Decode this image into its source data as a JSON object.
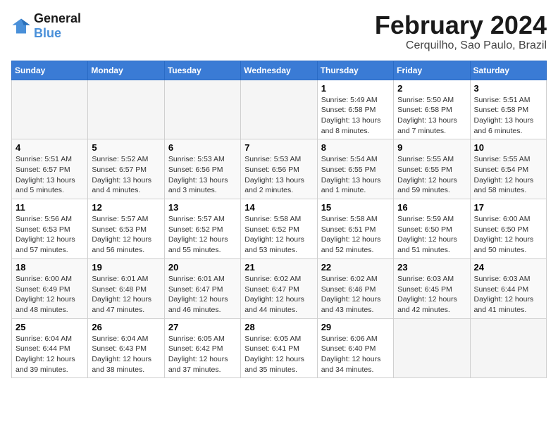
{
  "logo": {
    "line1": "General",
    "line2": "Blue"
  },
  "title": "February 2024",
  "location": "Cerquilho, Sao Paulo, Brazil",
  "weekdays": [
    "Sunday",
    "Monday",
    "Tuesday",
    "Wednesday",
    "Thursday",
    "Friday",
    "Saturday"
  ],
  "weeks": [
    [
      {
        "day": "",
        "info": ""
      },
      {
        "day": "",
        "info": ""
      },
      {
        "day": "",
        "info": ""
      },
      {
        "day": "",
        "info": ""
      },
      {
        "day": "1",
        "info": "Sunrise: 5:49 AM\nSunset: 6:58 PM\nDaylight: 13 hours\nand 8 minutes."
      },
      {
        "day": "2",
        "info": "Sunrise: 5:50 AM\nSunset: 6:58 PM\nDaylight: 13 hours\nand 7 minutes."
      },
      {
        "day": "3",
        "info": "Sunrise: 5:51 AM\nSunset: 6:58 PM\nDaylight: 13 hours\nand 6 minutes."
      }
    ],
    [
      {
        "day": "4",
        "info": "Sunrise: 5:51 AM\nSunset: 6:57 PM\nDaylight: 13 hours\nand 5 minutes."
      },
      {
        "day": "5",
        "info": "Sunrise: 5:52 AM\nSunset: 6:57 PM\nDaylight: 13 hours\nand 4 minutes."
      },
      {
        "day": "6",
        "info": "Sunrise: 5:53 AM\nSunset: 6:56 PM\nDaylight: 13 hours\nand 3 minutes."
      },
      {
        "day": "7",
        "info": "Sunrise: 5:53 AM\nSunset: 6:56 PM\nDaylight: 13 hours\nand 2 minutes."
      },
      {
        "day": "8",
        "info": "Sunrise: 5:54 AM\nSunset: 6:55 PM\nDaylight: 13 hours\nand 1 minute."
      },
      {
        "day": "9",
        "info": "Sunrise: 5:55 AM\nSunset: 6:55 PM\nDaylight: 12 hours\nand 59 minutes."
      },
      {
        "day": "10",
        "info": "Sunrise: 5:55 AM\nSunset: 6:54 PM\nDaylight: 12 hours\nand 58 minutes."
      }
    ],
    [
      {
        "day": "11",
        "info": "Sunrise: 5:56 AM\nSunset: 6:53 PM\nDaylight: 12 hours\nand 57 minutes."
      },
      {
        "day": "12",
        "info": "Sunrise: 5:57 AM\nSunset: 6:53 PM\nDaylight: 12 hours\nand 56 minutes."
      },
      {
        "day": "13",
        "info": "Sunrise: 5:57 AM\nSunset: 6:52 PM\nDaylight: 12 hours\nand 55 minutes."
      },
      {
        "day": "14",
        "info": "Sunrise: 5:58 AM\nSunset: 6:52 PM\nDaylight: 12 hours\nand 53 minutes."
      },
      {
        "day": "15",
        "info": "Sunrise: 5:58 AM\nSunset: 6:51 PM\nDaylight: 12 hours\nand 52 minutes."
      },
      {
        "day": "16",
        "info": "Sunrise: 5:59 AM\nSunset: 6:50 PM\nDaylight: 12 hours\nand 51 minutes."
      },
      {
        "day": "17",
        "info": "Sunrise: 6:00 AM\nSunset: 6:50 PM\nDaylight: 12 hours\nand 50 minutes."
      }
    ],
    [
      {
        "day": "18",
        "info": "Sunrise: 6:00 AM\nSunset: 6:49 PM\nDaylight: 12 hours\nand 48 minutes."
      },
      {
        "day": "19",
        "info": "Sunrise: 6:01 AM\nSunset: 6:48 PM\nDaylight: 12 hours\nand 47 minutes."
      },
      {
        "day": "20",
        "info": "Sunrise: 6:01 AM\nSunset: 6:47 PM\nDaylight: 12 hours\nand 46 minutes."
      },
      {
        "day": "21",
        "info": "Sunrise: 6:02 AM\nSunset: 6:47 PM\nDaylight: 12 hours\nand 44 minutes."
      },
      {
        "day": "22",
        "info": "Sunrise: 6:02 AM\nSunset: 6:46 PM\nDaylight: 12 hours\nand 43 minutes."
      },
      {
        "day": "23",
        "info": "Sunrise: 6:03 AM\nSunset: 6:45 PM\nDaylight: 12 hours\nand 42 minutes."
      },
      {
        "day": "24",
        "info": "Sunrise: 6:03 AM\nSunset: 6:44 PM\nDaylight: 12 hours\nand 41 minutes."
      }
    ],
    [
      {
        "day": "25",
        "info": "Sunrise: 6:04 AM\nSunset: 6:44 PM\nDaylight: 12 hours\nand 39 minutes."
      },
      {
        "day": "26",
        "info": "Sunrise: 6:04 AM\nSunset: 6:43 PM\nDaylight: 12 hours\nand 38 minutes."
      },
      {
        "day": "27",
        "info": "Sunrise: 6:05 AM\nSunset: 6:42 PM\nDaylight: 12 hours\nand 37 minutes."
      },
      {
        "day": "28",
        "info": "Sunrise: 6:05 AM\nSunset: 6:41 PM\nDaylight: 12 hours\nand 35 minutes."
      },
      {
        "day": "29",
        "info": "Sunrise: 6:06 AM\nSunset: 6:40 PM\nDaylight: 12 hours\nand 34 minutes."
      },
      {
        "day": "",
        "info": ""
      },
      {
        "day": "",
        "info": ""
      }
    ]
  ]
}
